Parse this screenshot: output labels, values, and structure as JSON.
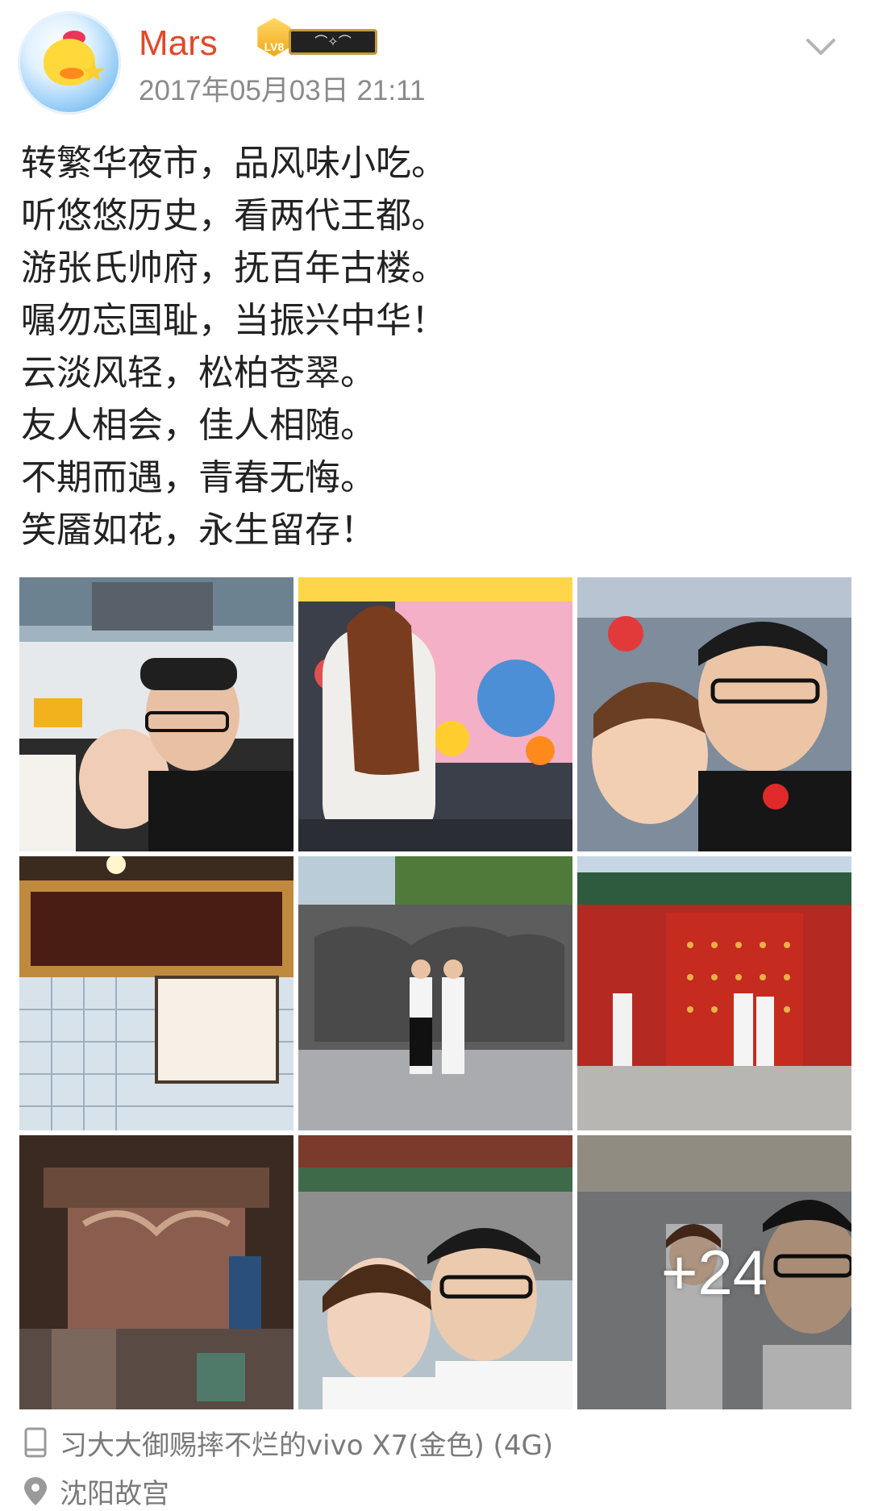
{
  "header": {
    "username": "Mars",
    "level_badge": "LV8",
    "timestamp": "2017年05月03日 21:11",
    "more_icon": "chevron-down-icon",
    "username_color": "#e0492a"
  },
  "post": {
    "lines": [
      "转繁华夜市，品风味小吃。",
      "听悠悠历史，看两代王都。",
      "游张氏帅府，抚百年古楼。",
      "嘱勿忘国耻，当振兴中华！",
      "云淡风轻，松柏苍翠。",
      "友人相会，佳人相随。",
      "不期而遇，青春无悔。",
      "笑靥如花，永生留存！"
    ]
  },
  "photos": {
    "count_shown": 9,
    "more_label": "+24"
  },
  "footer": {
    "device": "习大大御赐摔不烂的vivo X7(金色) (4G)",
    "device_icon": "phone-icon",
    "location": "沈阳故宫",
    "location_icon": "location-pin-icon"
  }
}
